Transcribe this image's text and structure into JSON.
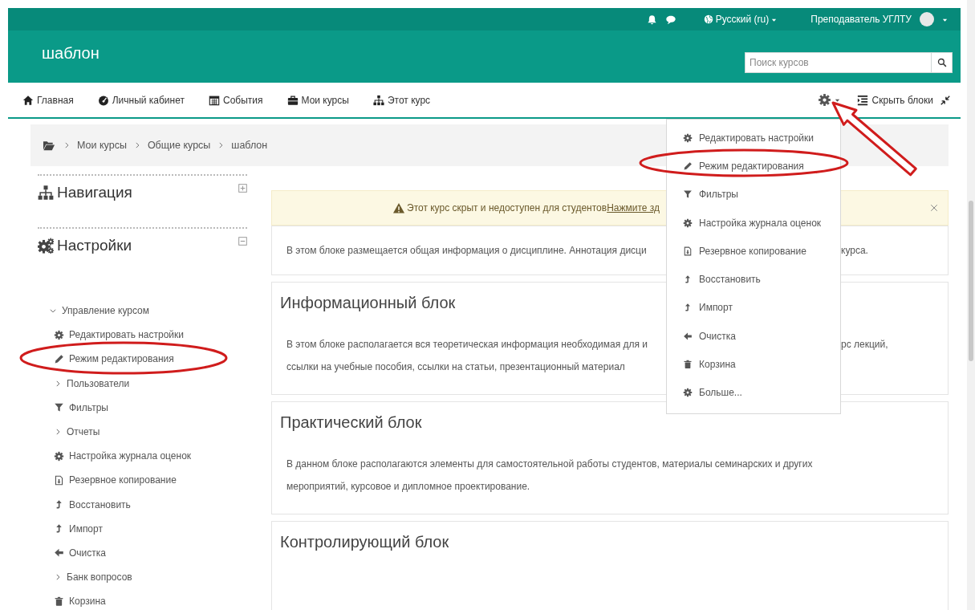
{
  "top_bar": {
    "language": "Русский (ru)",
    "user": "Преподаватель УГЛТУ"
  },
  "header": {
    "title": "шаблон",
    "search": {
      "placeholder": "Поиск курсов"
    }
  },
  "nav": {
    "items": [
      {
        "label": "Главная",
        "kind": "home"
      },
      {
        "label": "Личный кабинет",
        "kind": "gauge"
      },
      {
        "label": "События",
        "kind": "calendar"
      },
      {
        "label": "Мои курсы",
        "kind": "briefcase"
      },
      {
        "label": "Этот курс",
        "kind": "sitemap"
      }
    ],
    "hide_blocks": "Скрыть блоки"
  },
  "breadcrumb": [
    "Мои курсы",
    "Общие курсы",
    "шаблон"
  ],
  "blocks": [
    {
      "title": "Навигация",
      "kind": "sitemap",
      "expanded": false
    },
    {
      "title": "Настройки",
      "kind": "gears",
      "expanded": true,
      "children": [
        {
          "label": "Управление курсом",
          "kind": "branch",
          "expanded": true,
          "children": [
            {
              "label": "Редактировать настройки",
              "kind": "gear"
            },
            {
              "label": "Режим редактирования",
              "kind": "pencil"
            },
            {
              "label": "Пользователи",
              "kind": "branch",
              "expanded": false
            },
            {
              "label": "Фильтры",
              "kind": "filter"
            },
            {
              "label": "Отчеты",
              "kind": "branch",
              "expanded": false
            },
            {
              "label": "Настройка журнала оценок",
              "kind": "gear"
            },
            {
              "label": "Резервное копирование",
              "kind": "backup"
            },
            {
              "label": "Восстановить",
              "kind": "restore"
            },
            {
              "label": "Импорт",
              "kind": "restore"
            },
            {
              "label": "Очистка",
              "kind": "back"
            },
            {
              "label": "Банк вопросов",
              "kind": "branch",
              "expanded": false
            },
            {
              "label": "Корзина",
              "kind": "trash"
            }
          ]
        }
      ]
    }
  ],
  "notice": {
    "text": "Этот курс скрыт и недоступен для студентов",
    "link": "Нажмите зд"
  },
  "sections": [
    {
      "lines": [
        {
          "left": "В этом блоке размещается общая информация о дисциплине. Аннотация дисци",
          "right": "курса."
        }
      ]
    },
    {
      "title": "Информационный блок",
      "lines": [
        {
          "left": "В этом блоке располагается вся теоретическая информация необходимая для и",
          "right": "рс лекций,"
        },
        {
          "left": "ссылки на учебные пособия, ссылки на статьи, презентационный материал"
        }
      ]
    },
    {
      "title": "Практический блок",
      "lines": [
        {
          "left": "В данном блоке располагаются элементы для самостоятельной работы студентов, материалы семинарских и других"
        },
        {
          "left": "мероприятий, курсовое и дипломное проектирование."
        }
      ]
    },
    {
      "title": "Контролирующий блок"
    }
  ],
  "settings_menu": {
    "items": [
      {
        "label": "Редактировать настройки",
        "kind": "gear"
      },
      {
        "label": "Режим редактирования",
        "kind": "pencil"
      },
      {
        "label": "Фильтры",
        "kind": "filter"
      },
      {
        "label": "Настройка журнала оценок",
        "kind": "gear"
      },
      {
        "label": "Резервное копирование",
        "kind": "backup"
      },
      {
        "label": "Восстановить",
        "kind": "restore"
      },
      {
        "label": "Импорт",
        "kind": "restore"
      },
      {
        "label": "Очистка",
        "kind": "back"
      },
      {
        "label": "Корзина",
        "kind": "trash"
      },
      {
        "label": "Больше...",
        "kind": "gear"
      }
    ]
  }
}
